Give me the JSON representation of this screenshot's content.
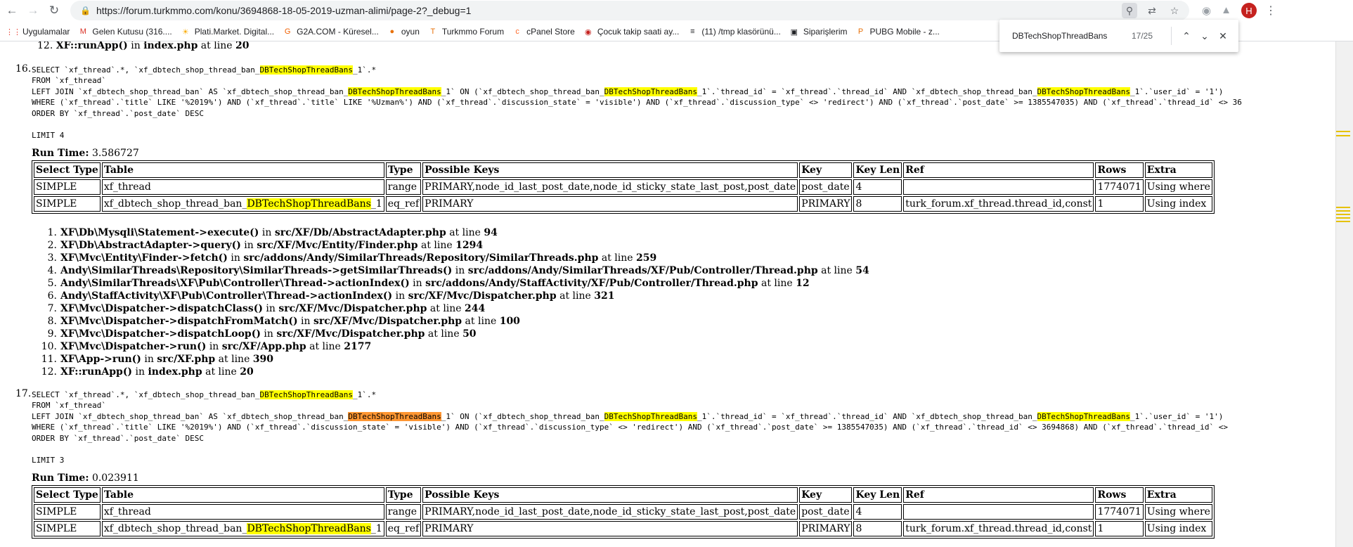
{
  "browser": {
    "url": "https://forum.turkmmo.com/konu/3694868-18-05-2019-uzman-alimi/page-2?_debug=1",
    "profile_initial": "H",
    "bookmarks": [
      {
        "label": "Uygulamalar",
        "icon": "apps-grid-icon",
        "color": "#ea4335"
      },
      {
        "label": "Gelen Kutusu (316....",
        "icon": "gmail-icon",
        "color": "#d93025"
      },
      {
        "label": "Plati.Market. Digital...",
        "icon": "sun-icon",
        "color": "#f9ab00"
      },
      {
        "label": "G2A.COM - Küresel...",
        "icon": "g2a-icon",
        "color": "#f05f00"
      },
      {
        "label": "oyun",
        "icon": "oyun-icon",
        "color": "#e8710a"
      },
      {
        "label": "Turkmmo Forum",
        "icon": "turkmmo-icon",
        "color": "#e8710a"
      },
      {
        "label": "cPanel Store",
        "icon": "cpanel-icon",
        "color": "#ff6c2c"
      },
      {
        "label": "Çocuk takip saati ay...",
        "icon": "saat-icon",
        "color": "#c5221f"
      },
      {
        "label": "(11) /tmp klasörünü...",
        "icon": "stackoverflow-icon",
        "color": "#202124"
      },
      {
        "label": "Siparişlerim",
        "icon": "siparis-icon",
        "color": "#202124"
      },
      {
        "label": "PUBG Mobile - z...",
        "icon": "pubg-icon",
        "color": "#e8710a"
      }
    ]
  },
  "find": {
    "query": "DBTechShopThreadBans",
    "count": "17/25"
  },
  "prev_tail": {
    "n": "12.",
    "fn": "XF::runApp()",
    "in": " in ",
    "file": "index.php",
    "at": " at line ",
    "line": "20"
  },
  "queries": [
    {
      "number": "16.",
      "sql": {
        "l1a": "SELECT `xf_thread`.*, `xf_dbtech_shop_thread_ban_",
        "hl": "DBTechShopThreadBans",
        "l1b": "_1`.*",
        "l2": "FROM `xf_thread`",
        "l3a": "LEFT JOIN `xf_dbtech_shop_thread_ban` AS `xf_dbtech_shop_thread_ban_",
        "l3b": "_1` ON (`xf_dbtech_shop_thread_ban_",
        "l3c": "_1`.`thread_id` = `xf_thread`.`thread_id` AND `xf_dbtech_shop_thread_ban_",
        "l3d": "_1`.`user_id` = '1')",
        "l4": "WHERE (`xf_thread`.`title` LIKE '%2019%') AND (`xf_thread`.`title` LIKE '%Uzman%') AND (`xf_thread`.`discussion_state` = 'visible') AND (`xf_thread`.`discussion_type` <> 'redirect') AND (`xf_thread`.`post_date` >= 1385547035) AND (`xf_thread`.`thread_id` <> 36",
        "l5": "ORDER BY `xf_thread`.`post_date` DESC",
        "limit": "LIMIT 4"
      },
      "run_time_label": "Run Time:",
      "run_time": "3.586727",
      "headers": [
        "Select Type",
        "Table",
        "Type",
        "Possible Keys",
        "Key",
        "Key Len",
        "Ref",
        "Rows",
        "Extra"
      ],
      "rows": [
        {
          "select_type": "SIMPLE",
          "table_a": "xf_thread",
          "table_hl": "",
          "table_b": "",
          "type": "range",
          "possible_keys": "PRIMARY,node_id_last_post_date,node_id_sticky_state_last_post,post_date",
          "key": "post_date",
          "key_len": "4",
          "ref": "",
          "rows": "1774071",
          "extra": "Using where"
        },
        {
          "select_type": "SIMPLE",
          "table_a": "xf_dbtech_shop_thread_ban_",
          "table_hl": "DBTechShopThreadBans",
          "table_b": "_1",
          "type": "eq_ref",
          "possible_keys": "PRIMARY",
          "key": "PRIMARY",
          "key_len": "8",
          "ref": "turk_forum.xf_thread.thread_id,const",
          "rows": "1",
          "extra": "Using index"
        }
      ],
      "trace": [
        {
          "n": "1.",
          "fn": "XF\\Db\\Mysqli\\Statement->execute()",
          "file": "src/XF/Db/AbstractAdapter.php",
          "line": "94"
        },
        {
          "n": "2.",
          "fn": "XF\\Db\\AbstractAdapter->query()",
          "file": "src/XF/Mvc/Entity/Finder.php",
          "line": "1294"
        },
        {
          "n": "3.",
          "fn": "XF\\Mvc\\Entity\\Finder->fetch()",
          "file": "src/addons/Andy/SimilarThreads/Repository/SimilarThreads.php",
          "line": "259"
        },
        {
          "n": "4.",
          "fn": "Andy\\SimilarThreads\\Repository\\SimilarThreads->getSimilarThreads()",
          "file": "src/addons/Andy/SimilarThreads/XF/Pub/Controller/Thread.php",
          "line": "54"
        },
        {
          "n": "5.",
          "fn": "Andy\\SimilarThreads\\XF\\Pub\\Controller\\Thread->actionIndex()",
          "file": "src/addons/Andy/StaffActivity/XF/Pub/Controller/Thread.php",
          "line": "12"
        },
        {
          "n": "6.",
          "fn": "Andy\\StaffActivity\\XF\\Pub\\Controller\\Thread->actionIndex()",
          "file": "src/XF/Mvc/Dispatcher.php",
          "line": "321"
        },
        {
          "n": "7.",
          "fn": "XF\\Mvc\\Dispatcher->dispatchClass()",
          "file": "src/XF/Mvc/Dispatcher.php",
          "line": "244"
        },
        {
          "n": "8.",
          "fn": "XF\\Mvc\\Dispatcher->dispatchFromMatch()",
          "file": "src/XF/Mvc/Dispatcher.php",
          "line": "100"
        },
        {
          "n": "9.",
          "fn": "XF\\Mvc\\Dispatcher->dispatchLoop()",
          "file": "src/XF/Mvc/Dispatcher.php",
          "line": "50"
        },
        {
          "n": "10.",
          "fn": "XF\\Mvc\\Dispatcher->run()",
          "file": "src/XF/App.php",
          "line": "2177"
        },
        {
          "n": "11.",
          "fn": "XF\\App->run()",
          "file": "src/XF.php",
          "line": "390"
        },
        {
          "n": "12.",
          "fn": "XF::runApp()",
          "file": "index.php",
          "line": "20"
        }
      ]
    },
    {
      "number": "17.",
      "sql": {
        "l1a": "SELECT `xf_thread`.*, `xf_dbtech_shop_thread_ban_",
        "hl": "DBTechShopThreadBans",
        "l1b": "_1`.*",
        "l2": "FROM `xf_thread`",
        "l3a": "LEFT JOIN `xf_dbtech_shop_thread_ban` AS `xf_dbtech_shop_thread_ban_",
        "l3b": "_1` ON (`xf_dbtech_shop_thread_ban_",
        "l3c": "_1`.`thread_id` = `xf_thread`.`thread_id` AND `xf_dbtech_shop_thread_ban_",
        "l3d": "_1`.`user_id` = '1')",
        "l4": "WHERE (`xf_thread`.`title` LIKE '%2019%') AND (`xf_thread`.`discussion_state` = 'visible') AND (`xf_thread`.`discussion_type` <> 'redirect') AND (`xf_thread`.`post_date` >= 1385547035) AND (`xf_thread`.`thread_id` <> 3694868) AND (`xf_thread`.`thread_id` <>",
        "l5": "ORDER BY `xf_thread`.`post_date` DESC",
        "limit": "LIMIT 3"
      },
      "run_time_label": "Run Time:",
      "run_time": "0.023911",
      "rows": [
        {
          "select_type": "SIMPLE",
          "table_a": "xf_thread",
          "table_hl": "",
          "table_b": "",
          "type": "range",
          "possible_keys": "PRIMARY,node_id_last_post_date,node_id_sticky_state_last_post,post_date",
          "key": "post_date",
          "key_len": "4",
          "ref": "",
          "rows": "1774071",
          "extra": "Using where"
        },
        {
          "select_type": "SIMPLE",
          "table_a": "xf_dbtech_shop_thread_ban_",
          "table_hl": "DBTechShopThreadBans",
          "table_b": "_1",
          "type": "eq_ref",
          "possible_keys": "PRIMARY",
          "key": "PRIMARY",
          "key_len": "8",
          "ref": "turk_forum.xf_thread.thread_id,const",
          "rows": "1",
          "extra": "Using index"
        }
      ]
    }
  ],
  "trace_in": " in ",
  "trace_at": " at line "
}
